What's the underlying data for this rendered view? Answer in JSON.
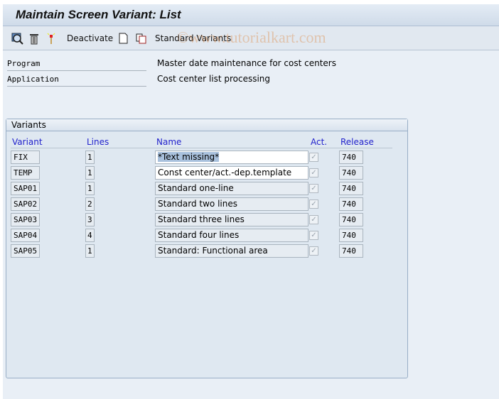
{
  "title": "Maintain Screen Variant: List",
  "toolbar": {
    "deactivate": "Deactivate",
    "standard_variants": "Standard Variants",
    "watermark": "©www.tutorialkart.com"
  },
  "header": {
    "program_label": "Program",
    "program_value": "Master date maintenance for cost centers",
    "application_label": "Application",
    "application_value": "Cost center list processing"
  },
  "group": {
    "title": "Variants",
    "columns": [
      "Variant",
      "Lines",
      "Name",
      "Act.",
      "Release"
    ],
    "rows": [
      {
        "variant": "FIX",
        "lines": "1",
        "name": "*Text missing*",
        "active": true,
        "release": "740"
      },
      {
        "variant": "TEMP",
        "lines": "1",
        "name": "Const center/act.-dep.template",
        "active": true,
        "release": "740"
      },
      {
        "variant": "SAP01",
        "lines": "1",
        "name": "Standard one-line",
        "active": true,
        "release": "740"
      },
      {
        "variant": "SAP02",
        "lines": "2",
        "name": "Standard two lines",
        "active": true,
        "release": "740"
      },
      {
        "variant": "SAP03",
        "lines": "3",
        "name": "Standard three lines",
        "active": true,
        "release": "740"
      },
      {
        "variant": "SAP04",
        "lines": "4",
        "name": "Standard four lines",
        "active": true,
        "release": "740"
      },
      {
        "variant": "SAP05",
        "lines": "1",
        "name": "Standard: Functional area",
        "active": true,
        "release": "740"
      }
    ]
  }
}
